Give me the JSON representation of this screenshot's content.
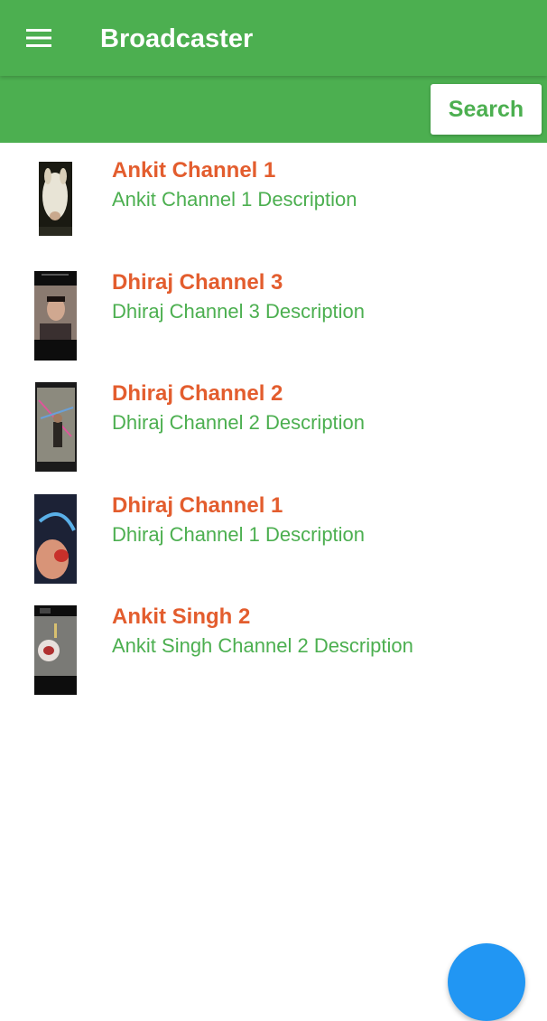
{
  "app_bar": {
    "title": "Broadcaster",
    "menu_icon": "hamburger-menu-icon",
    "background_color": "#4caf50"
  },
  "search": {
    "button_label": "Search"
  },
  "channels": [
    {
      "name": "Ankit Channel 1",
      "description": "Ankit Channel 1 Description",
      "thumbnail": "goat-head-photo"
    },
    {
      "name": "Dhiraj Channel 3",
      "description": "Dhiraj Channel 3 Description",
      "thumbnail": "selfie-screenshot"
    },
    {
      "name": "Dhiraj Channel 2",
      "description": "Dhiraj Channel 2 Description",
      "thumbnail": "street-photo-screenshot"
    },
    {
      "name": "Dhiraj Channel 1",
      "description": "Dhiraj Channel 1 Description",
      "thumbnail": "hand-with-toy-photo"
    },
    {
      "name": "Ankit Singh 2",
      "description": "Ankit Singh Channel 2 Description",
      "thumbnail": "cake-screenshot"
    }
  ],
  "colors": {
    "primary": "#4caf50",
    "channel_name": "#e35d2e",
    "channel_description": "#4caf50",
    "fab": "#2196f3"
  }
}
